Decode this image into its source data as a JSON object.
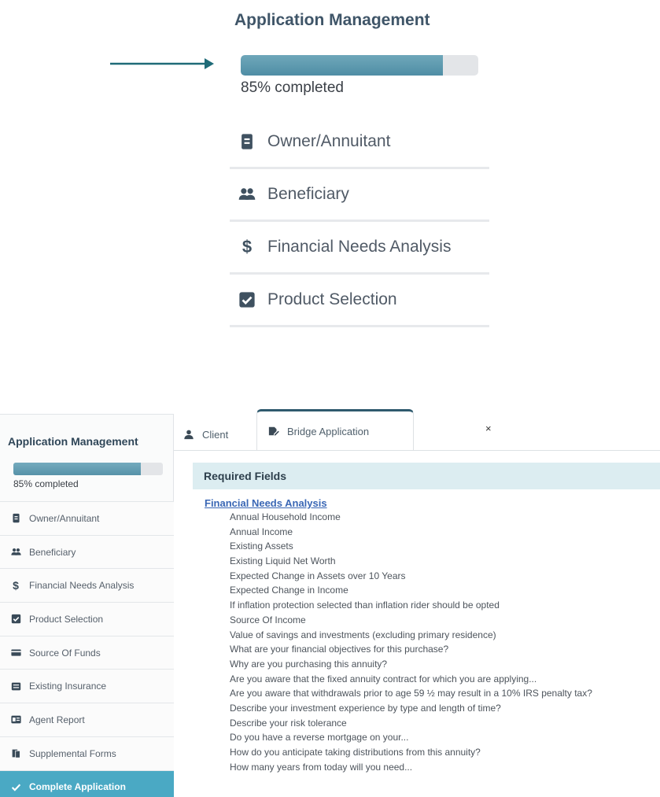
{
  "zoom": {
    "title": "Application Management",
    "progress_value": 85,
    "progress_label": "85% completed",
    "items": [
      {
        "label": "Owner/Annuitant",
        "icon": "id-card-icon"
      },
      {
        "label": "Beneficiary",
        "icon": "users-icon"
      },
      {
        "label": "Financial Needs Analysis",
        "icon": "dollar-icon"
      },
      {
        "label": "Product Selection",
        "icon": "checkbox-icon"
      }
    ]
  },
  "sidebar": {
    "title": "Application Management",
    "progress_value": 85,
    "progress_label": "85% completed",
    "items": [
      {
        "label": "Owner/Annuitant",
        "icon": "id-card-icon"
      },
      {
        "label": "Beneficiary",
        "icon": "users-icon"
      },
      {
        "label": "Financial Needs Analysis",
        "icon": "dollar-icon"
      },
      {
        "label": "Product Selection",
        "icon": "checkbox-icon"
      },
      {
        "label": "Source Of Funds",
        "icon": "money-icon"
      },
      {
        "label": "Existing Insurance",
        "icon": "list-icon"
      },
      {
        "label": "Agent Report",
        "icon": "report-icon"
      },
      {
        "label": "Supplemental Forms",
        "icon": "forms-icon"
      },
      {
        "label": "Complete Application",
        "icon": "check-icon"
      }
    ]
  },
  "tabs": {
    "client": "Client",
    "bridge": "Bridge Application",
    "close": "×"
  },
  "content": {
    "header": "Required Fields",
    "section_link": "Financial Needs Analysis",
    "fields": [
      "Annual Household Income",
      "Annual Income",
      "Existing Assets",
      "Existing Liquid Net Worth",
      "Expected Change in Assets over 10 Years",
      "Expected Change in Income",
      "If inflation protection selected than inflation rider should be opted",
      "Source Of Income",
      "Value of savings and investments (excluding primary residence)",
      "What are your financial objectives for this purchase?",
      "Why are you purchasing this annuity?",
      "Are you aware that the fixed annuity contract for which you are applying...",
      "Are you aware that withdrawals prior to age 59 ½ may result in a 10% IRS penalty tax?",
      "Describe your investment experience by type and length of time?",
      "Describe your risk tolerance",
      "Do you have a reverse mortgage on your...",
      "How do you anticipate taking distributions from this annuity?",
      "How many years from today will you need..."
    ]
  },
  "colors": {
    "accent": "#4aa9c4",
    "progress": "#5692a8",
    "arrow": "#1f6b78",
    "header_bg": "#dcedf1",
    "link": "#3a67b5"
  }
}
